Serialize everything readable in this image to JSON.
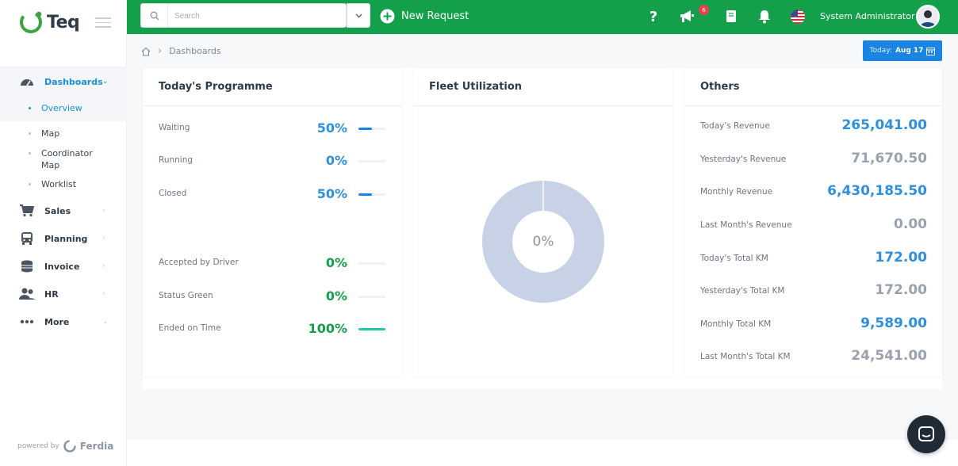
{
  "app": {
    "logo_text": "Teq",
    "powered_by": "powered by",
    "powered_brand": "Ferdia"
  },
  "sidebar": {
    "items": [
      {
        "label": "Dashboards",
        "icon": "gauge-icon"
      },
      {
        "label": "Sales",
        "icon": "cart-icon"
      },
      {
        "label": "Planning",
        "icon": "bus-icon"
      },
      {
        "label": "Invoice",
        "icon": "coins-icon"
      },
      {
        "label": "HR",
        "icon": "users-icon"
      },
      {
        "label": "More",
        "icon": "dots-icon"
      }
    ],
    "dashboard_sub": [
      {
        "label": "Overview"
      },
      {
        "label": "Map"
      },
      {
        "label": "Coordinator Map"
      },
      {
        "label": "Worklist"
      }
    ]
  },
  "header": {
    "search_placeholder": "Search",
    "new_request": "New Request",
    "notification_count": "6",
    "user_name": "System Administrator"
  },
  "breadcrumb": {
    "current": "Dashboards"
  },
  "today": {
    "prefix": "Today:",
    "date": "Aug 17"
  },
  "programme": {
    "title": "Today's Programme",
    "rows": [
      {
        "label": "Waiting",
        "value": "50%",
        "level": 0.5,
        "color": "#2e8fdc"
      },
      {
        "label": "Running",
        "value": "0%",
        "level": 0,
        "color": "#2e8fdc"
      },
      {
        "label": "Closed",
        "value": "50%",
        "level": 0.5,
        "color": "#2e8fdc"
      },
      {
        "label": "Accepted by Driver",
        "value": "0%",
        "level": 0,
        "color": "#14a04a"
      },
      {
        "label": "Status Green",
        "value": "0%",
        "level": 0,
        "color": "#14a04a"
      },
      {
        "label": "Ended on Time",
        "value": "100%",
        "level": 1,
        "color": "#14a04a"
      }
    ]
  },
  "fleet": {
    "title": "Fleet Utilization",
    "value": "0%"
  },
  "others": {
    "title": "Others",
    "rows": [
      {
        "label": "Today's Revenue",
        "value": "265,041.00",
        "color": "#2e8fdc"
      },
      {
        "label": "Yesterday's Revenue",
        "value": "71,670.50",
        "color": "#9aa2ad"
      },
      {
        "label": "Monthly Revenue",
        "value": "6,430,185.50",
        "color": "#2e8fdc"
      },
      {
        "label": "Last Month's Revenue",
        "value": "0.00",
        "color": "#9aa2ad"
      },
      {
        "label": "Today's Total KM",
        "value": "172.00",
        "color": "#2e8fdc"
      },
      {
        "label": "Yesterday's Total KM",
        "value": "172.00",
        "color": "#9aa2ad"
      },
      {
        "label": "Monthly Total KM",
        "value": "9,589.00",
        "color": "#2e8fdc"
      },
      {
        "label": "Last Month's Total KM",
        "value": "24,541.00",
        "color": "#9aa2ad"
      }
    ]
  },
  "colors": {
    "brand_green": "#14a04a",
    "accent_blue": "#1a84e3"
  }
}
